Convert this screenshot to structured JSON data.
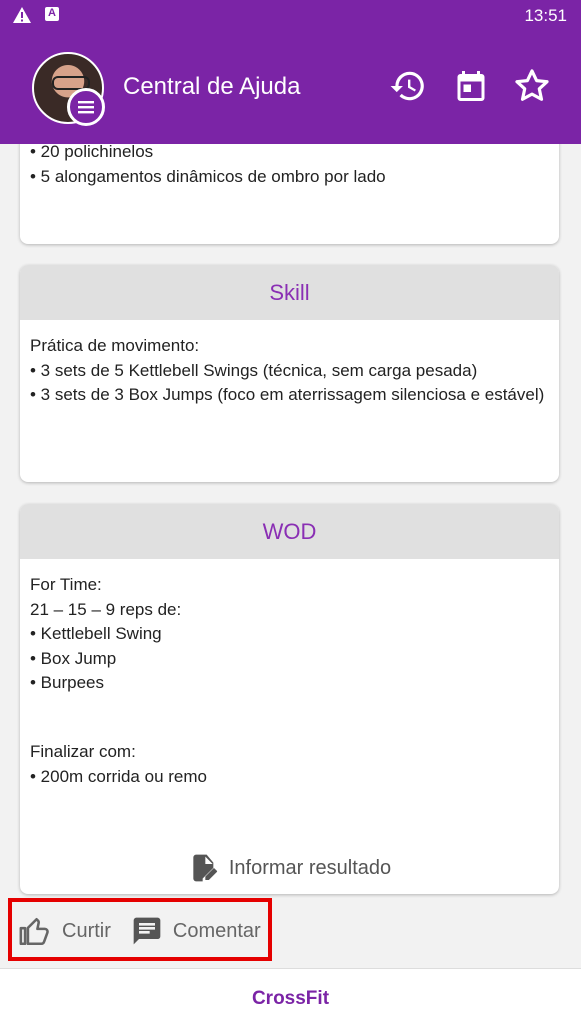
{
  "status": {
    "time": "13:51",
    "icons": [
      "warning-icon",
      "app-a-icon"
    ]
  },
  "appbar": {
    "title": "Central de Ajuda",
    "icons": [
      "history-icon",
      "calendar-icon",
      "star-outline-icon"
    ]
  },
  "cards": [
    {
      "header": "",
      "lines": [
        "• 20 polichinelos",
        "• 5 alongamentos dinâmicos de ombro por lado"
      ]
    },
    {
      "header": "Skill",
      "lines": [
        "Prática de movimento:",
        "• 3 sets de 5 Kettlebell Swings (técnica, sem carga pesada)",
        "• 3 sets de 3 Box Jumps (foco em aterrissagem silenciosa e estável)"
      ]
    },
    {
      "header": "WOD",
      "lines": [
        "For Time:",
        "21 – 15 – 9 reps de:",
        "• Kettlebell Swing",
        "• Box Jump",
        "• Burpees",
        "",
        "",
        "Finalizar com:",
        "• 200m corrida ou remo"
      ],
      "action_label": "Informar resultado"
    }
  ],
  "actions": {
    "like_label": "Curtir",
    "comment_label": "Comentar"
  },
  "bottom": {
    "label": "CrossFit"
  },
  "colors": {
    "primary": "#7b24a6",
    "header_text": "#8a2fb4",
    "highlight": "#e50000"
  }
}
